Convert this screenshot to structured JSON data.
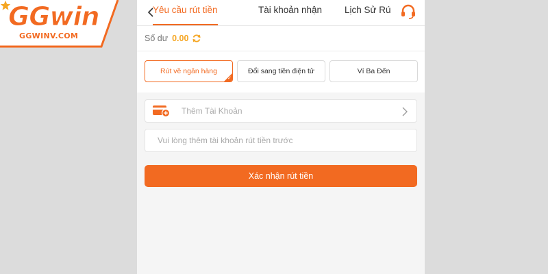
{
  "logo": {
    "brand_gg": "GG",
    "brand_win": "win",
    "url": "GGWINV.COM"
  },
  "header": {
    "tabs": [
      {
        "label": "Yêu cầu rút tiền",
        "active": true
      },
      {
        "label": "Tài khoản nhận",
        "active": false
      },
      {
        "label": "Lịch Sử Rú",
        "active": false
      }
    ]
  },
  "balance": {
    "label": "Số dư",
    "value": "0.00"
  },
  "methods": [
    {
      "label": "Rút về ngân hàng",
      "selected": true
    },
    {
      "label": "Đổi sang tiền điện tử",
      "selected": false
    },
    {
      "label": "Ví Ba Đến",
      "selected": false
    }
  ],
  "add_account": {
    "label": "Thêm Tài Khoản"
  },
  "account_input": {
    "placeholder": "Vui lòng thêm tài khoản rút tiền trước",
    "value": ""
  },
  "confirm_button": {
    "label": "Xác nhận rút tiền"
  },
  "icons": {
    "back": "chevron-left-icon",
    "support": "headset-icon",
    "refresh": "refresh-icon",
    "card": "card-add-icon",
    "chevron": "chevron-right-icon"
  },
  "colors": {
    "accent": "#f26a21",
    "balance": "#f5a623",
    "panel_bg": "#f5f5f5",
    "page_bg": "#dcdcdc"
  }
}
